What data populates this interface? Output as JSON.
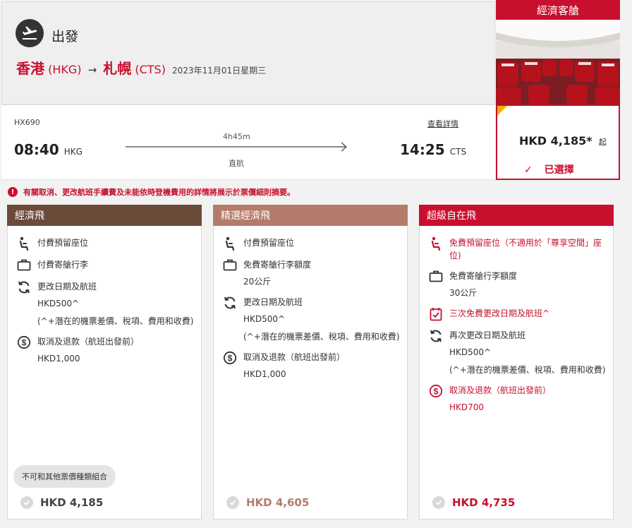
{
  "header": {
    "depart_label": "出發",
    "origin_city": "香港",
    "origin_code": "(HKG)",
    "arrow": "→",
    "dest_city": "札幌",
    "dest_code": "(CTS)",
    "date": "2023年11月01日星期三"
  },
  "cabin": {
    "title": "經濟客艙"
  },
  "flight": {
    "number": "HX690",
    "detail_link": "查看詳情",
    "dep_time": "08:40",
    "dep_code": "HKG",
    "duration": "4h45m",
    "stops": "直航",
    "arr_time": "14:25",
    "arr_code": "CTS"
  },
  "price_card": {
    "amount": "HKD 4,185*",
    "suffix": "起",
    "selected_label": "已選擇",
    "tick": "✓"
  },
  "notice": {
    "icon": "!",
    "text": "有關取消、更改航班手續費及未能依時登機費用的詳情將展示於票價細則摘要。"
  },
  "fares": [
    {
      "title": "經濟飛",
      "header_color": "#6b4a3a",
      "seat": "付費預留座位",
      "bag": "付費寄艙行李",
      "change": "更改日期及航班",
      "change_fee": "HKD500^",
      "change_note": "(^+潛在的機票差價、稅項、費用和收費)",
      "refund": "取消及退款（航班出發前）",
      "refund_fee": "HKD1,000",
      "combo_badge": "不可和其他票價種類組合",
      "price": "HKD 4,185",
      "price_color": "#444444"
    },
    {
      "title": "精選經濟飛",
      "header_color": "#b57b6a",
      "seat": "付費預留座位",
      "bag": "免費寄艙行李額度",
      "bag_allowance": "20公斤",
      "change": "更改日期及航班",
      "change_fee": "HKD500^",
      "change_note": "(^+潛在的機票差價、稅項、費用和收費)",
      "refund": "取消及退款（航班出發前）",
      "refund_fee": "HKD1,000",
      "price": "HKD 4,605",
      "price_color": "#b57b6a"
    },
    {
      "title": "超級自在飛",
      "header_color": "#c8102e",
      "seat": "免費預留座位（不適用於「尊享空間」座位)",
      "bag": "免費寄艙行李額度",
      "bag_allowance": "30公斤",
      "free_change": "三次免費更改日期及航班^",
      "change": "再次更改日期及航班",
      "change_fee": "HKD500^",
      "change_note": "(^+潛在的機票差價、稅項、費用和收費)",
      "refund": "取消及退款（航班出發前）",
      "refund_fee": "HKD700",
      "price": "HKD 4,735",
      "price_color": "#c8102e"
    }
  ],
  "icons": {
    "plane": "airplane-takeoff-icon",
    "seat": "seat-icon",
    "bag": "luggage-icon",
    "change": "refresh-icon",
    "refund": "dollar-circle-icon",
    "calendar": "calendar-check-icon",
    "check": "check-circle-icon"
  },
  "colors": {
    "brand_red": "#c8102e",
    "selected_corner": "#f0b400"
  }
}
